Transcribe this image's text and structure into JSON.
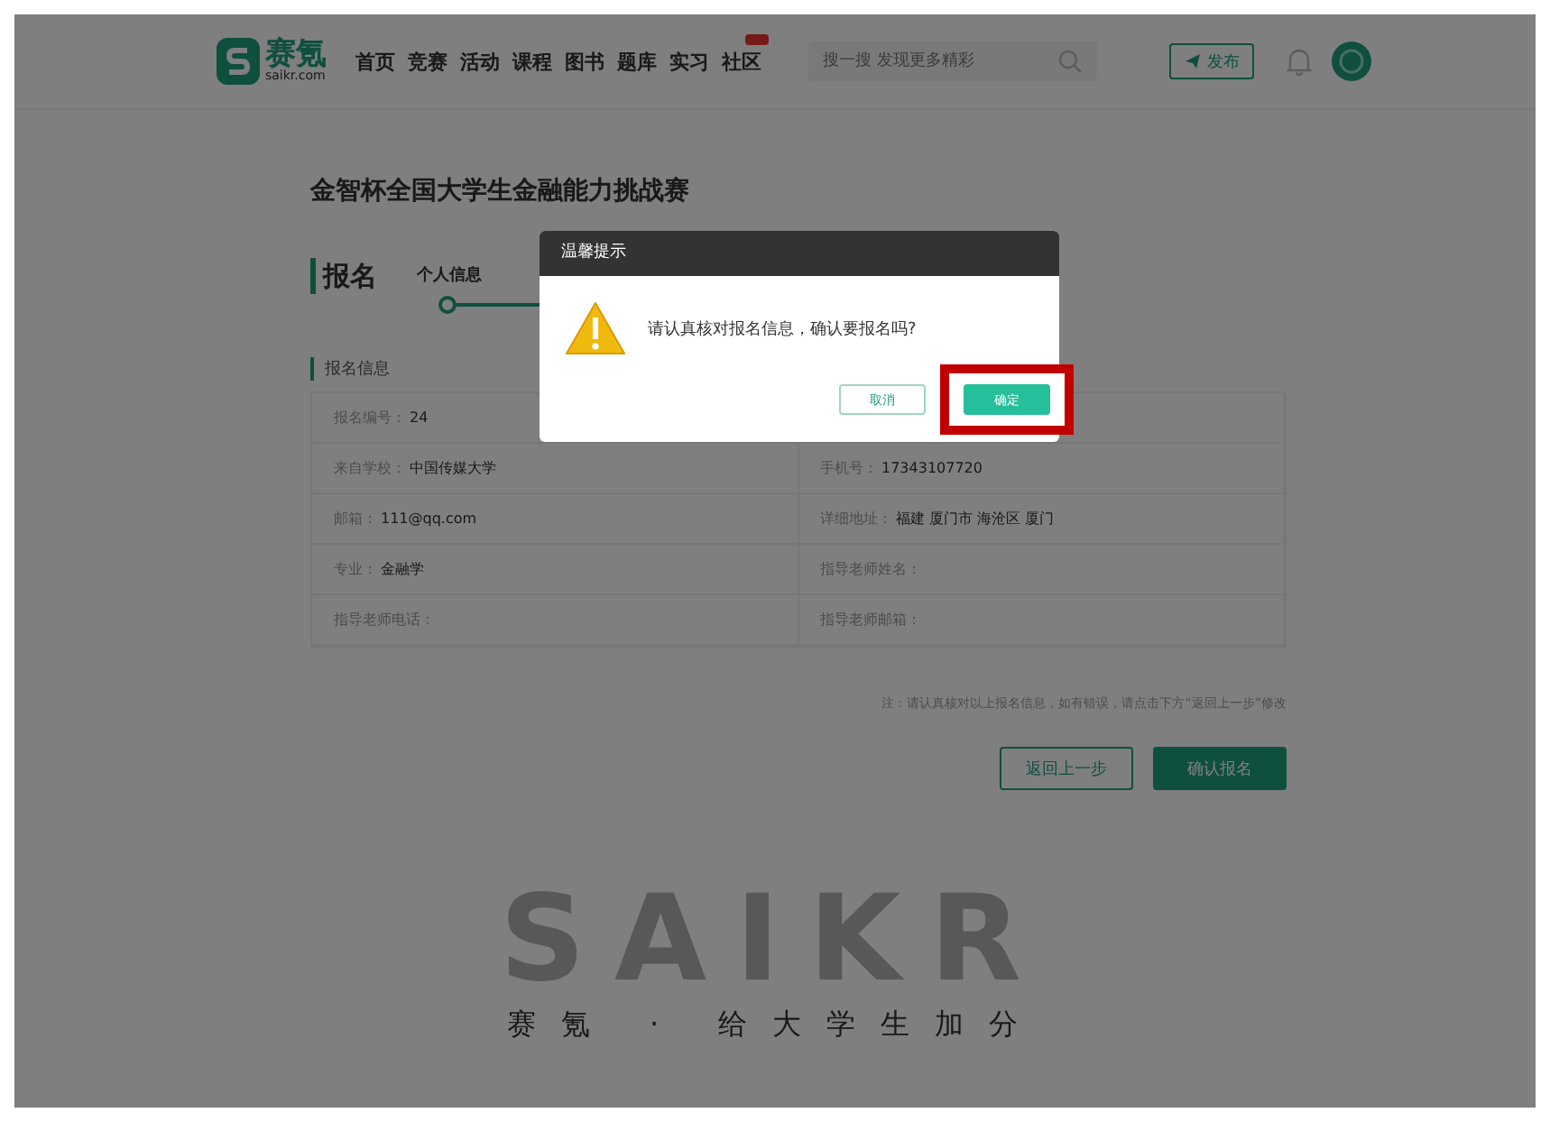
{
  "header": {
    "logo": {
      "name": "赛氪",
      "domain": "saikr.com"
    },
    "nav": [
      {
        "label": "首页",
        "badge": false
      },
      {
        "label": "竞赛",
        "badge": false
      },
      {
        "label": "活动",
        "badge": false
      },
      {
        "label": "课程",
        "badge": false
      },
      {
        "label": "图书",
        "badge": false
      },
      {
        "label": "题库",
        "badge": false
      },
      {
        "label": "实习",
        "badge": false
      },
      {
        "label": "社区",
        "badge": true
      }
    ],
    "search": {
      "placeholder": "搜一搜 发现更多精彩"
    },
    "publish_button": "发布"
  },
  "page_title": "金智杯全国大学生金融能力挑战赛",
  "section_title": "报名",
  "steps": [
    {
      "label": "个人信息",
      "selected": true
    }
  ],
  "info_title": "报名信息",
  "info_rows": [
    [
      {
        "label": "报名编号：",
        "value": "24"
      }
    ],
    [
      {
        "label": "来自学校：",
        "value": "中国传媒大学"
      },
      {
        "label": "手机号：",
        "value": "17343107720"
      }
    ],
    [
      {
        "label": "邮箱：",
        "value": "111@qq.com"
      },
      {
        "label": "详细地址：",
        "value": "福建 厦门市 海沧区 厦门"
      }
    ],
    [
      {
        "label": "专业：",
        "value": "金融学"
      },
      {
        "label": "指导老师姓名："
      }
    ],
    [
      {
        "label": "指导老师电话："
      },
      {
        "label": "指导老师邮箱："
      }
    ]
  ],
  "note": "注：请认真核对以上报名信息，如有错误，请点击下方“返回上一步”修改",
  "buttons": [
    {
      "label": "返回上一步",
      "kind": "outline"
    },
    {
      "label": "确认报名",
      "kind": "primary"
    }
  ],
  "footer": {
    "brand": "SAIKR",
    "slogan": "赛氪 · 给大学生加分"
  },
  "dialog": {
    "title": "温馨提示",
    "message": "请认真核对报名信息，确认要报名吗?",
    "buttons": [
      {
        "label": "取消",
        "kind": "outline",
        "highlighted": false
      },
      {
        "label": "确定",
        "kind": "primary",
        "highlighted": true
      }
    ]
  }
}
